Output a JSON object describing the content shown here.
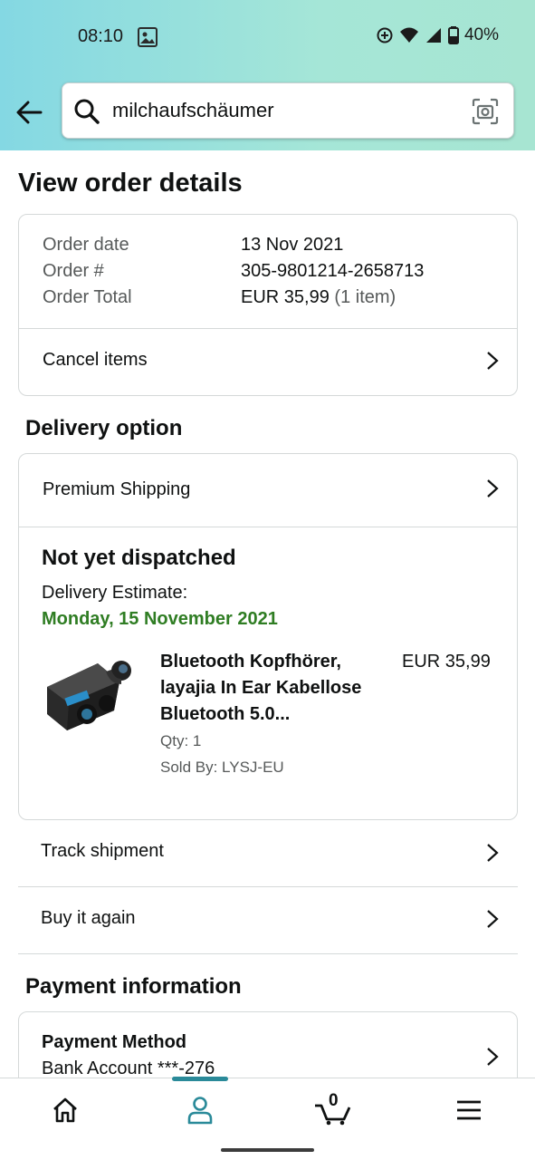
{
  "status_bar": {
    "time": "08:10",
    "battery": "40%"
  },
  "search": {
    "query": "milchaufschäumer"
  },
  "page_title": "View order details",
  "order_info": {
    "date_label": "Order date",
    "date_value": "13 Nov 2021",
    "number_label": "Order #",
    "number_value": "305-9801214-2658713",
    "total_label": "Order Total",
    "total_value": "EUR 35,99",
    "total_items": "(1 item)",
    "cancel_label": "Cancel items"
  },
  "delivery": {
    "section_title": "Delivery option",
    "shipping_label": "Premium Shipping",
    "status": "Not yet dispatched",
    "estimate_label": "Delivery Estimate:",
    "estimate_date": "Monday, 15 November 2021",
    "product": {
      "title": "Bluetooth Kopfhörer, layajia In Ear Kabellose Bluetooth 5.0...",
      "price": "EUR 35,99",
      "qty": "Qty: 1",
      "seller": "Sold By: LYSJ-EU"
    }
  },
  "actions": {
    "track": "Track shipment",
    "buy_again": "Buy it again"
  },
  "payment": {
    "section_title": "Payment information",
    "method_label": "Payment Method",
    "method_value": "Bank Account ***-276"
  },
  "bottom_nav": {
    "cart_count": "0",
    "active": "account"
  },
  "colors": {
    "accent": "#2a8a99",
    "green": "#2f7d23",
    "header_start": "#84d8e3",
    "header_end": "#a7e5d2"
  }
}
